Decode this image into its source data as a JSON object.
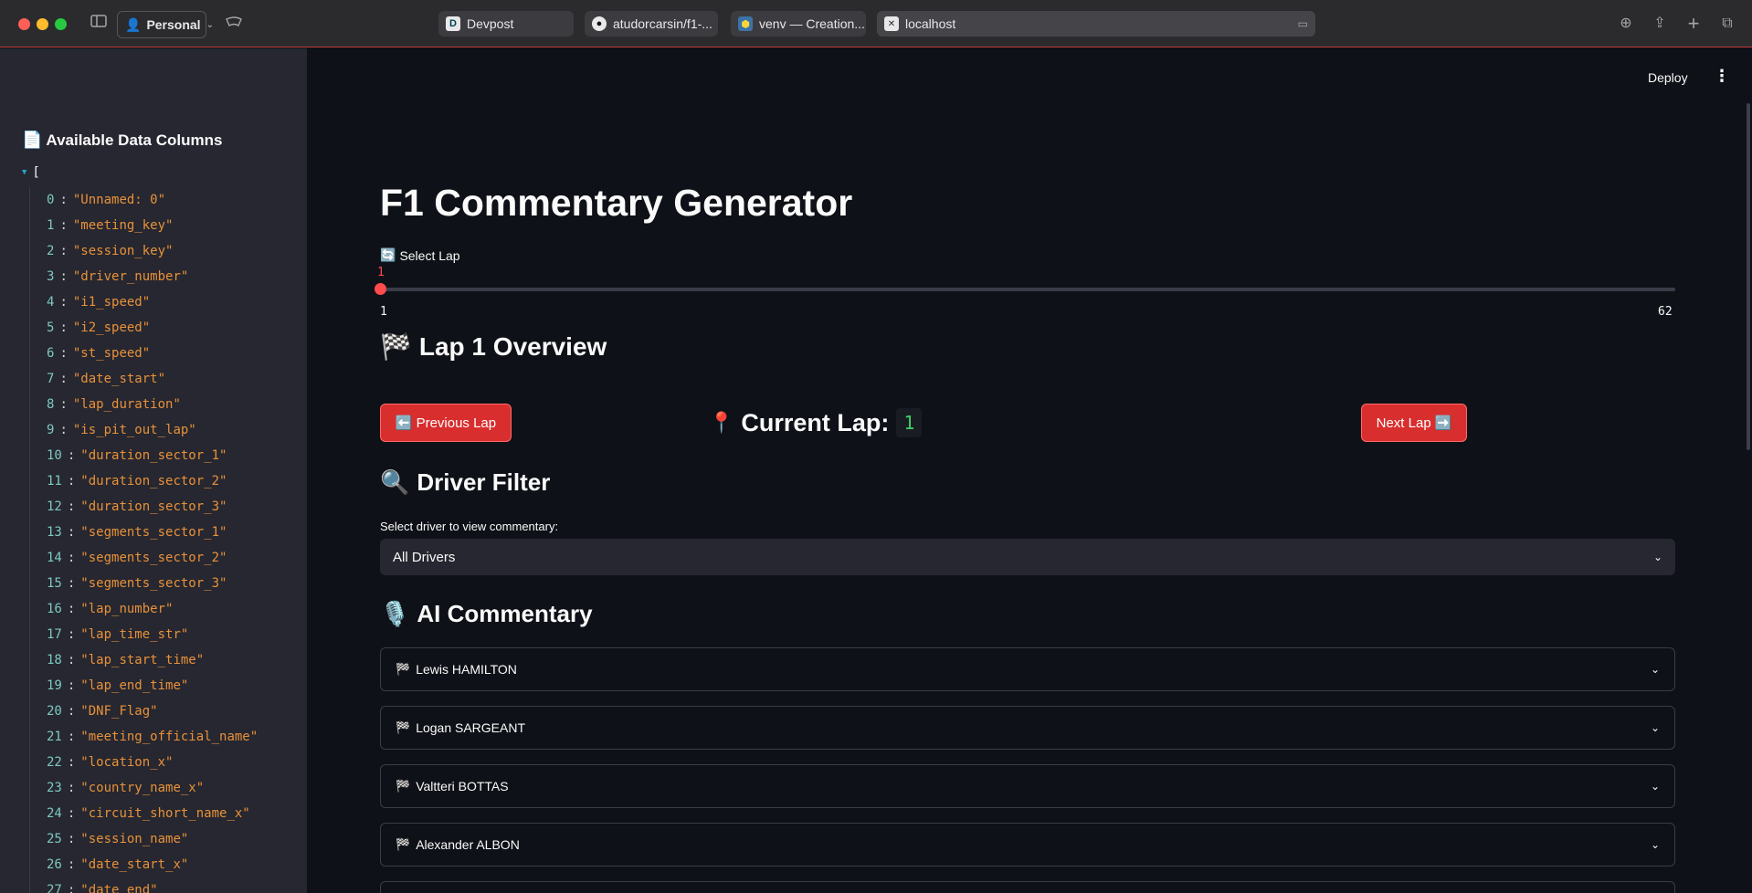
{
  "browser": {
    "profile": "Personal",
    "tabs": [
      {
        "label": "Devpost",
        "favicon": "D"
      },
      {
        "label": "atudorcarsin/f1-...",
        "favicon": "github"
      },
      {
        "label": "venv — Creation...",
        "favicon": "python"
      },
      {
        "label": "localhost",
        "favicon": "close-x"
      }
    ]
  },
  "sidebar": {
    "title": "Available Data Columns",
    "open_bracket": "[",
    "columns": [
      {
        "i": "0",
        "v": "\"Unnamed: 0\""
      },
      {
        "i": "1",
        "v": "\"meeting_key\""
      },
      {
        "i": "2",
        "v": "\"session_key\""
      },
      {
        "i": "3",
        "v": "\"driver_number\""
      },
      {
        "i": "4",
        "v": "\"i1_speed\""
      },
      {
        "i": "5",
        "v": "\"i2_speed\""
      },
      {
        "i": "6",
        "v": "\"st_speed\""
      },
      {
        "i": "7",
        "v": "\"date_start\""
      },
      {
        "i": "8",
        "v": "\"lap_duration\""
      },
      {
        "i": "9",
        "v": "\"is_pit_out_lap\""
      },
      {
        "i": "10",
        "v": "\"duration_sector_1\""
      },
      {
        "i": "11",
        "v": "\"duration_sector_2\""
      },
      {
        "i": "12",
        "v": "\"duration_sector_3\""
      },
      {
        "i": "13",
        "v": "\"segments_sector_1\""
      },
      {
        "i": "14",
        "v": "\"segments_sector_2\""
      },
      {
        "i": "15",
        "v": "\"segments_sector_3\""
      },
      {
        "i": "16",
        "v": "\"lap_number\""
      },
      {
        "i": "17",
        "v": "\"lap_time_str\""
      },
      {
        "i": "18",
        "v": "\"lap_start_time\""
      },
      {
        "i": "19",
        "v": "\"lap_end_time\""
      },
      {
        "i": "20",
        "v": "\"DNF_Flag\""
      },
      {
        "i": "21",
        "v": "\"meeting_official_name\""
      },
      {
        "i": "22",
        "v": "\"location_x\""
      },
      {
        "i": "23",
        "v": "\"country_name_x\""
      },
      {
        "i": "24",
        "v": "\"circuit_short_name_x\""
      },
      {
        "i": "25",
        "v": "\"session_name\""
      },
      {
        "i": "26",
        "v": "\"date_start_x\""
      },
      {
        "i": "27",
        "v": "\"date_end\""
      }
    ]
  },
  "header": {
    "deploy": "Deploy"
  },
  "main": {
    "title": "F1 Commentary Generator",
    "slider": {
      "label": "Select Lap",
      "value": 1,
      "min": 1,
      "max": 62,
      "value_text": "1",
      "min_text": "1",
      "max_text": "62"
    },
    "overview_title": "Lap 1 Overview",
    "prev_button": "Previous Lap",
    "next_button": "Next Lap",
    "current_lap_label": "Current Lap:",
    "current_lap_value": "1",
    "driver_filter_title": "Driver Filter",
    "filter_label": "Select driver to view commentary:",
    "filter_selected": "All Drivers",
    "commentary_title": "AI Commentary",
    "drivers": [
      "Lewis HAMILTON",
      "Logan SARGEANT",
      "Valtteri BOTTAS",
      "Alexander ALBON"
    ]
  },
  "colors": {
    "accent": "#ff4b4b",
    "button": "#d92e2e",
    "sidebar_bg": "#262730",
    "main_bg": "#0e1117"
  }
}
